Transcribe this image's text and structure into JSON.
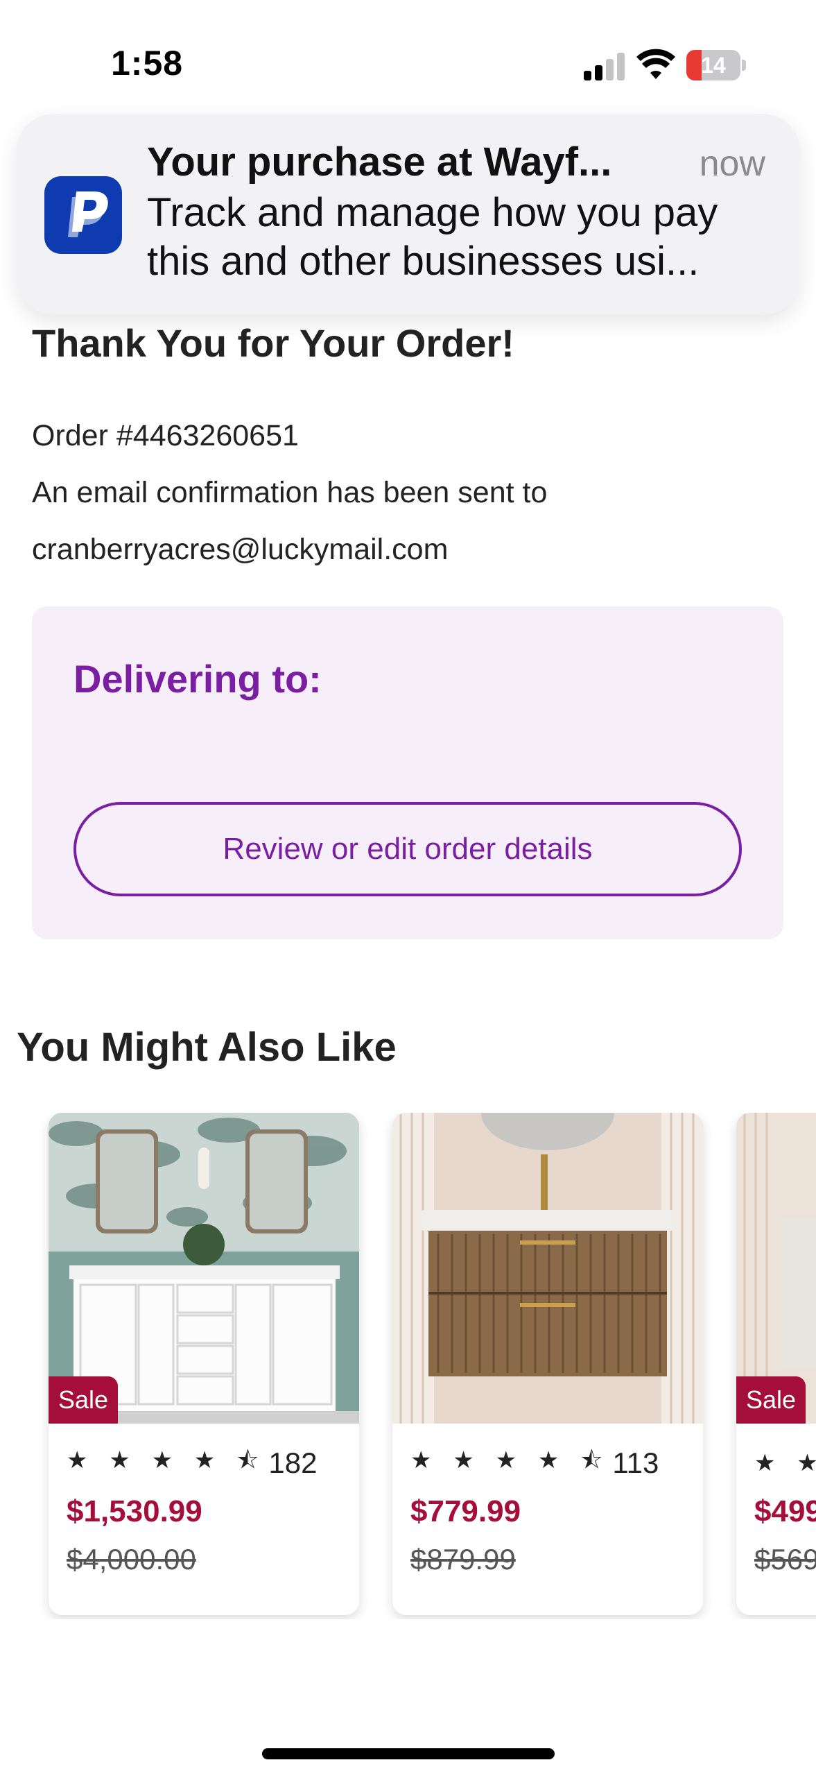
{
  "status_bar": {
    "time": "1:58",
    "battery_level": "14",
    "battery_color": "#e83a30"
  },
  "notification": {
    "app_icon": "paypal-icon",
    "title": "Your purchase at Wayf...",
    "time": "now",
    "body": "Track and manage how you pay this and other businesses usi..."
  },
  "confirmation": {
    "title": "Thank You for Your Order!",
    "order_number": "Order #4463260651",
    "email_notice": "An email confirmation has been sent to",
    "email": "cranberryacres@luckymail.com"
  },
  "delivery": {
    "label": "Delivering to:",
    "review_button": "Review or edit order details",
    "accent_color": "#7b1fa2"
  },
  "recommendations": {
    "title": "You Might Also Like",
    "products": [
      {
        "sale_badge": "Sale",
        "stars": "★ ★ ★ ★ ⯪",
        "rating": 4.5,
        "review_count": "182",
        "sale_price": "$1,530.99",
        "original_price": "$4,000.00"
      },
      {
        "sale_badge": "",
        "stars": "★ ★ ★ ★ ⯪",
        "rating": 4.5,
        "review_count": "113",
        "sale_price": "$779.99",
        "original_price": "$879.99"
      },
      {
        "sale_badge": "Sale",
        "stars": "★ ★",
        "review_count": "",
        "sale_price": "$499",
        "original_price": "$569"
      }
    ]
  }
}
